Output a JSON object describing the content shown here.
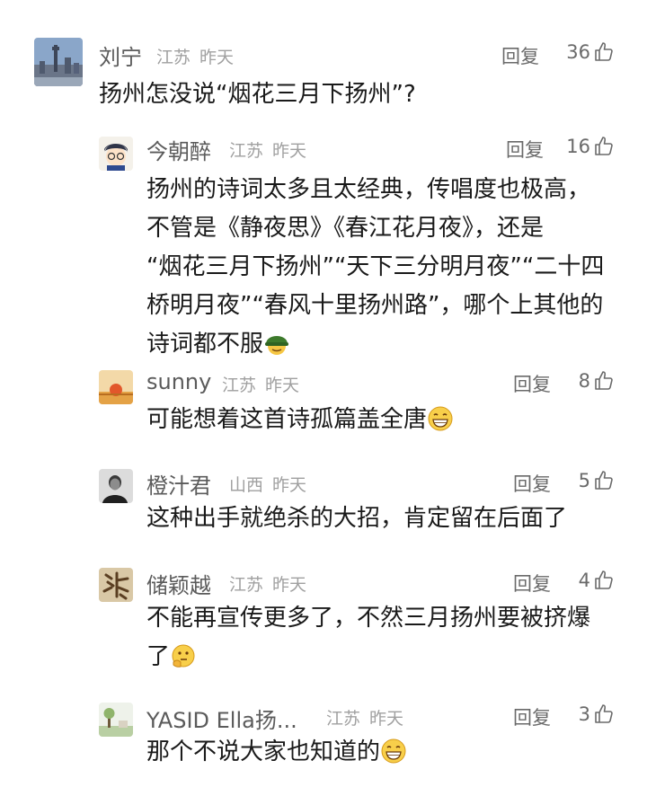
{
  "reply_label": "回复",
  "comments": [
    {
      "avatar": "city-tower-avatar",
      "name": "刘宁",
      "location": "江苏",
      "time": "昨天",
      "likes": "36",
      "lines": [
        "扬州怎没说“烟花三月下扬州”?"
      ]
    },
    {
      "avatar": "anime-boy-avatar",
      "name": "今朝醉",
      "location": "江苏",
      "time": "昨天",
      "likes": "16",
      "lines": [
        "扬州的诗词太多且太经典，传唱度也极高，",
        "不管是《静夜思》《春江花月夜》，还是",
        "“烟花三月下扬州”“天下三分明月夜”“二十四",
        "桥明月夜”“春风十里扬州路”，哪个上其他的",
        "诗词都不服"
      ],
      "emoji": "soldier-helmet-emoji"
    },
    {
      "avatar": "sunset-avatar",
      "name": "sunny",
      "location": "江苏",
      "time": "昨天",
      "likes": "8",
      "lines": [
        "可能想着这首诗孤篇盖全唐"
      ],
      "emoji": "grin-emoji"
    },
    {
      "avatar": "man-photo-avatar",
      "name": "橙汁君",
      "location": "山西",
      "time": "昨天",
      "likes": "5",
      "lines": [
        "这种出手就绝杀的大招，肯定留在后面了"
      ]
    },
    {
      "avatar": "calligraphy-avatar",
      "name": "储颖越",
      "location": "江苏",
      "time": "昨天",
      "likes": "4",
      "lines": [
        "不能再宣传更多了，不然三月扬州要被挤爆",
        "了"
      ],
      "emoji": "thinking-emoji"
    },
    {
      "avatar": "tree-garden-avatar",
      "name": "YASID Ella扬...",
      "location": "江苏",
      "time": "昨天",
      "likes": "3",
      "lines": [
        "那个不说大家也知道的"
      ],
      "emoji": "grin-emoji"
    }
  ]
}
